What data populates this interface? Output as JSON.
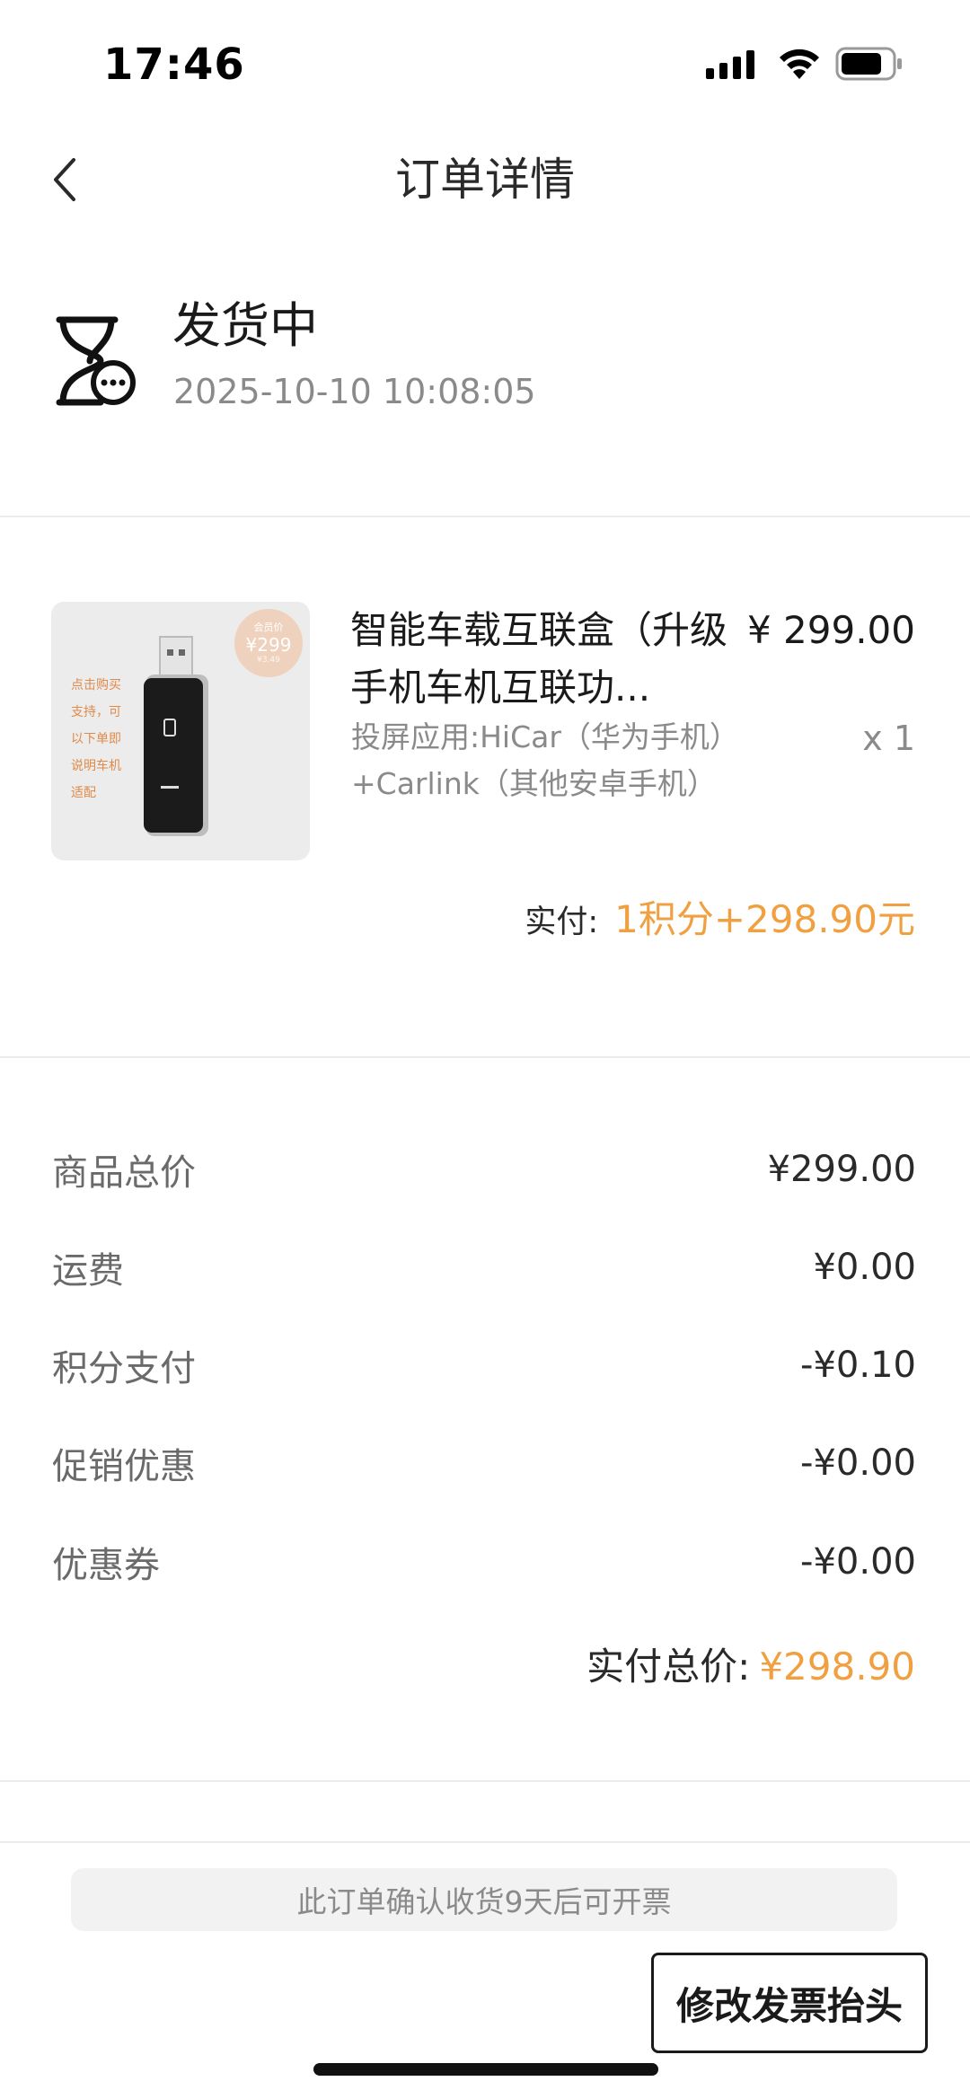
{
  "status_bar": {
    "time": "17:46"
  },
  "nav": {
    "title": "订单详情"
  },
  "order_status": {
    "title": "发货中",
    "timestamp": "2025-10-10 10:08:05"
  },
  "product": {
    "image_badge_label": "会员价",
    "image_badge_price": "¥299",
    "image_badge_old": "¥3.49",
    "image_side_text": "点击购买\n支持，可\n以下单即\n说明车机\n适配",
    "name": "智能车载互联盒（升级手机车机互联功...",
    "price": "¥ 299.00",
    "spec": "投屏应用:HiCar（华为手机）+Carlink（其他安卓手机）",
    "quantity": "x 1",
    "paid_label": "实付:",
    "paid_value": "1积分+298.90元"
  },
  "summary": {
    "rows": [
      {
        "label": "商品总价",
        "value": "¥299.00"
      },
      {
        "label": "运费",
        "value": "¥0.00"
      },
      {
        "label": "积分支付",
        "value": "-¥0.10"
      },
      {
        "label": "促销优惠",
        "value": "-¥0.00"
      },
      {
        "label": "优惠券",
        "value": "-¥0.00"
      }
    ],
    "total_label": "实付总价:",
    "total_value": "¥298.90"
  },
  "footer": {
    "notice": "此订单确认收货9天后可开票",
    "invoice_button": "修改发票抬头"
  },
  "colors": {
    "accent": "#f0a040",
    "muted": "#8a8a8a",
    "divider": "#ececec"
  }
}
